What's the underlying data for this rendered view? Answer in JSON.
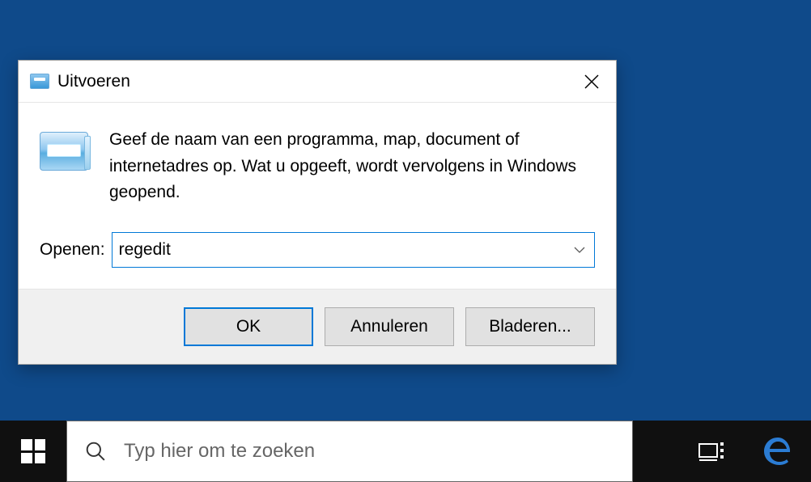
{
  "dialog": {
    "title": "Uitvoeren",
    "description": "Geef de naam van een programma, map, document of internetadres op. Wat u opgeeft, wordt vervolgens in Windows geopend.",
    "open_label": "Openen:",
    "input_value": "regedit",
    "buttons": {
      "ok": "OK",
      "cancel": "Annuleren",
      "browse": "Bladeren..."
    }
  },
  "taskbar": {
    "search_placeholder": "Typ hier om te zoeken"
  }
}
